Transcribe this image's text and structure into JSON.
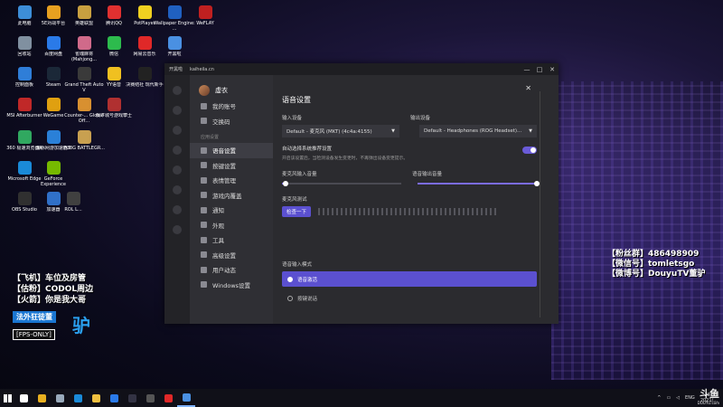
{
  "desktop": {
    "icons": [
      {
        "label": "此电脑",
        "color": "#3d8ed8"
      },
      {
        "label": "5E对战平台",
        "color": "#e8a020"
      },
      {
        "label": "英雄联盟",
        "color": "#c8a040"
      },
      {
        "label": "腾讯QQ",
        "color": "#e03030"
      },
      {
        "label": "PotPlayer",
        "color": "#f0d020"
      },
      {
        "label": "Wallpaper Engine: ...",
        "color": "#2060c0"
      },
      {
        "label": "WeFLAY",
        "color": "#c02020"
      },
      {
        "label": "回收站",
        "color": "#8090a0"
      },
      {
        "label": "百度网盘",
        "color": "#2a7ae8"
      },
      {
        "label": "雀魂麻将 (Mahjong...",
        "color": "#d06a8a"
      },
      {
        "label": "微信",
        "color": "#2dbb4d"
      },
      {
        "label": "网易云音乐",
        "color": "#e02828"
      },
      {
        "label": "开黑啦",
        "color": "#4a90e2"
      },
      {
        "label": "控制面板",
        "color": "#2f7ed8"
      },
      {
        "label": "Steam",
        "color": "#1b2838"
      },
      {
        "label": "Grand Theft Auto V",
        "color": "#3a3a3a"
      },
      {
        "label": "YY语音",
        "color": "#f0c020"
      },
      {
        "label": "决赛结社 现代新手",
        "color": "#222222"
      },
      {
        "label": "MSI Afterburner",
        "color": "#c02828"
      },
      {
        "label": "WeGame",
        "color": "#e0a010"
      },
      {
        "label": "Counter-... Global Off...",
        "color": "#d89030"
      },
      {
        "label": "我下城号游戏攀士",
        "color": "#b03030"
      },
      {
        "label": "360 极速浏览器X",
        "color": "#30a860"
      },
      {
        "label": "海豚网游加速器5",
        "color": "#2a80d8"
      },
      {
        "label": "PUBG BATTLEGR...",
        "color": "#c8a050"
      },
      {
        "label": "Microsoft Edge",
        "color": "#1a8ad8"
      },
      {
        "label": "GeForce Experience",
        "color": "#76b900"
      },
      {
        "label": "OBS Studio",
        "color": "#303030"
      },
      {
        "label": "加速器",
        "color": "#3070c8"
      },
      {
        "label": "ROL L...",
        "color": "#404040"
      }
    ]
  },
  "overlay_left": {
    "lines": [
      "【飞机】车位及房管",
      "【估粉】CODOL周边",
      "【火箭】你是我大哥"
    ],
    "badge": "法外狂徒董",
    "badge2": "[FPS-ONLY]",
    "bigchar": "驴"
  },
  "overlay_right": {
    "lines": [
      "【粉丝群】486498909",
      "【微信号】tomletsgo",
      "【微博号】DouyuTV董驴"
    ]
  },
  "window": {
    "title1": "开黑啦",
    "title2": "kaiheila.cn",
    "controls": [
      "—",
      "□",
      "✕"
    ],
    "profile_name": "虚衣",
    "nav_top": [
      {
        "label": "我的账号",
        "icon": "user-icon"
      },
      {
        "label": "交换码",
        "icon": "code-icon"
      }
    ],
    "nav_section": "应用设置",
    "nav_items": [
      {
        "label": "语音设置",
        "icon": "mic-icon",
        "active": true
      },
      {
        "label": "按键设置",
        "icon": "keyboard-icon"
      },
      {
        "label": "表情管理",
        "icon": "emoji-icon"
      },
      {
        "label": "游戏内覆盖",
        "icon": "overlay-icon"
      },
      {
        "label": "通知",
        "icon": "bell-icon"
      },
      {
        "label": "外观",
        "icon": "palette-icon"
      },
      {
        "label": "工具",
        "icon": "tool-icon"
      },
      {
        "label": "高级设置",
        "icon": "advanced-icon"
      },
      {
        "label": "用户动态",
        "icon": "activity-icon"
      },
      {
        "label": "Windows设置",
        "icon": "windows-icon"
      }
    ],
    "content": {
      "section_title": "语音设置",
      "input_label": "输入设备",
      "output_label": "输出设备",
      "input_value": "Default - 麦克风 (MKT) (4c4a:4155)",
      "output_value": "Default - Headphones (ROG Headset)...",
      "toggle_title": "自动选择系统推荐设置",
      "toggle_desc": "开启该设置后，当检测设备发生变更时，不再弹出设备变更提示。",
      "toggle_on": true,
      "input_volume_label": "麦克风输入音量",
      "output_volume_label": "语音输出音量",
      "input_volume": 0.03,
      "output_volume": 1.0,
      "mic_test_label": "麦克风测试",
      "mic_test_button": "检查一下",
      "mode_title": "语音输入模式",
      "mode_options": [
        "语音激活",
        "按键说话"
      ],
      "mode_selected": 0
    }
  },
  "taskbar": {
    "icons": [
      {
        "name": "search-icon",
        "color": "#ffffff"
      },
      {
        "name": "chrome-icon",
        "color": "#e8b020"
      },
      {
        "name": "task-view-icon",
        "color": "#9ab"
      },
      {
        "name": "edge-icon",
        "color": "#1a8ad8"
      },
      {
        "name": "file-explorer-icon",
        "color": "#f0c040"
      },
      {
        "name": "store-icon",
        "color": "#2a7ae8"
      },
      {
        "name": "steam-icon",
        "color": "#334"
      },
      {
        "name": "obs-icon",
        "color": "#555"
      },
      {
        "name": "netease-music-icon",
        "color": "#e02828"
      },
      {
        "name": "kaiheila-icon",
        "color": "#4a90e2"
      }
    ],
    "active_index": 9,
    "lang": "ENG",
    "time": "23:21",
    "date": "2021/..."
  },
  "watermark": {
    "brand": "斗鱼",
    "url": "DOUYU.com"
  }
}
